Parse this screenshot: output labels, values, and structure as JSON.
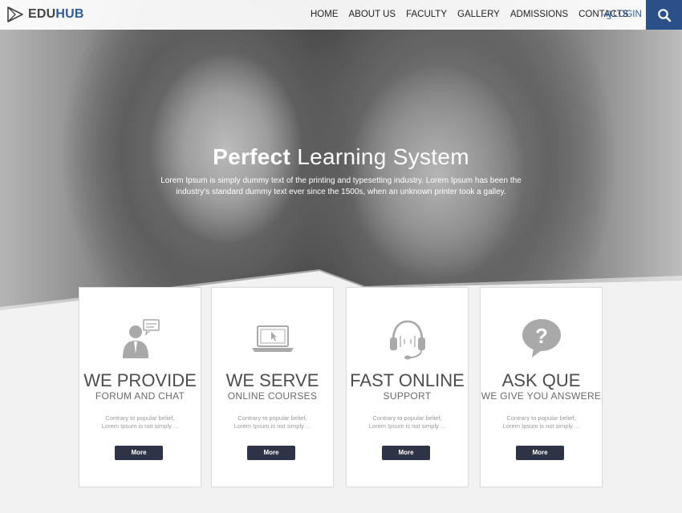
{
  "nav": {
    "logo_main": "EDU",
    "logo_accent": "HUB",
    "items": [
      "HOME",
      "ABOUT US",
      "FACULTY",
      "GALLERY",
      "ADMISSIONS",
      "CONTACTS"
    ],
    "login_label": "LOGIN",
    "accent_color": "#2b4f88"
  },
  "hero": {
    "title_bold": "Perfect",
    "title_rest": "Learning System",
    "text": "Lorem Ipsum is simply dummy text of the printing and typesetting industry. Lorem Ipsum has been the industry's standard dummy text ever since the 1500s, when an unknown printer took a galley."
  },
  "cards": [
    {
      "icon": "forum-chat-icon",
      "title": "WE PROVIDE",
      "subtitle": "FORUM AND CHAT",
      "text": "Contrary to popular belief, Lorem Ipsum is not simply ...",
      "button": "More"
    },
    {
      "icon": "laptop-icon",
      "title": "WE SERVE",
      "subtitle": "ONLINE COURSES",
      "text": "Contrary to popular belief, Lorem Ipsum is not simply ...",
      "button": "More"
    },
    {
      "icon": "headset-icon",
      "title": "FAST ONLINE",
      "subtitle": "SUPPORT",
      "text": "Contrary to popular belief, Lorem Ipsum is not simply ...",
      "button": "More"
    },
    {
      "icon": "question-bubble-icon",
      "title": "ASK QUE",
      "subtitle": "WE GIVE YOU ANSWERE",
      "text": "Contrary to popular belief, Lorem Ipsum is not simply ...",
      "button": "More"
    }
  ]
}
